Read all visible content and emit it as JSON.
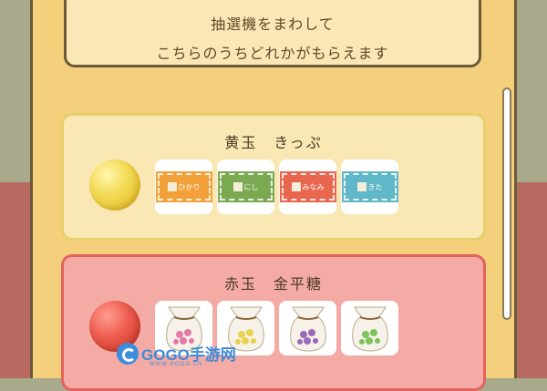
{
  "message": {
    "line1": "抽選機をまわして",
    "line2": "こちらのうちどれかがもらえます"
  },
  "prizes": [
    {
      "title": "黄玉　きっぷ",
      "ball_color": "yellow",
      "items": [
        {
          "type": "ticket",
          "label": "ひかり",
          "color": "#f2a13a"
        },
        {
          "type": "ticket",
          "label": "にし",
          "color": "#7ba952"
        },
        {
          "type": "ticket",
          "label": "みなみ",
          "color": "#e9664e"
        },
        {
          "type": "ticket",
          "label": "きた",
          "color": "#5fb7c7"
        }
      ]
    },
    {
      "title": "赤玉　金平糖",
      "ball_color": "red",
      "items": [
        {
          "type": "candy-bag",
          "candy_color": "#e47aa8"
        },
        {
          "type": "candy-bag",
          "candy_color": "#e9d24a"
        },
        {
          "type": "candy-bag",
          "candy_color": "#9a6ab8"
        },
        {
          "type": "candy-bag",
          "candy_color": "#7dc25a"
        }
      ]
    }
  ],
  "watermark": {
    "text": "GOGO手游网",
    "sub": "WWW.GOGO.CN"
  }
}
